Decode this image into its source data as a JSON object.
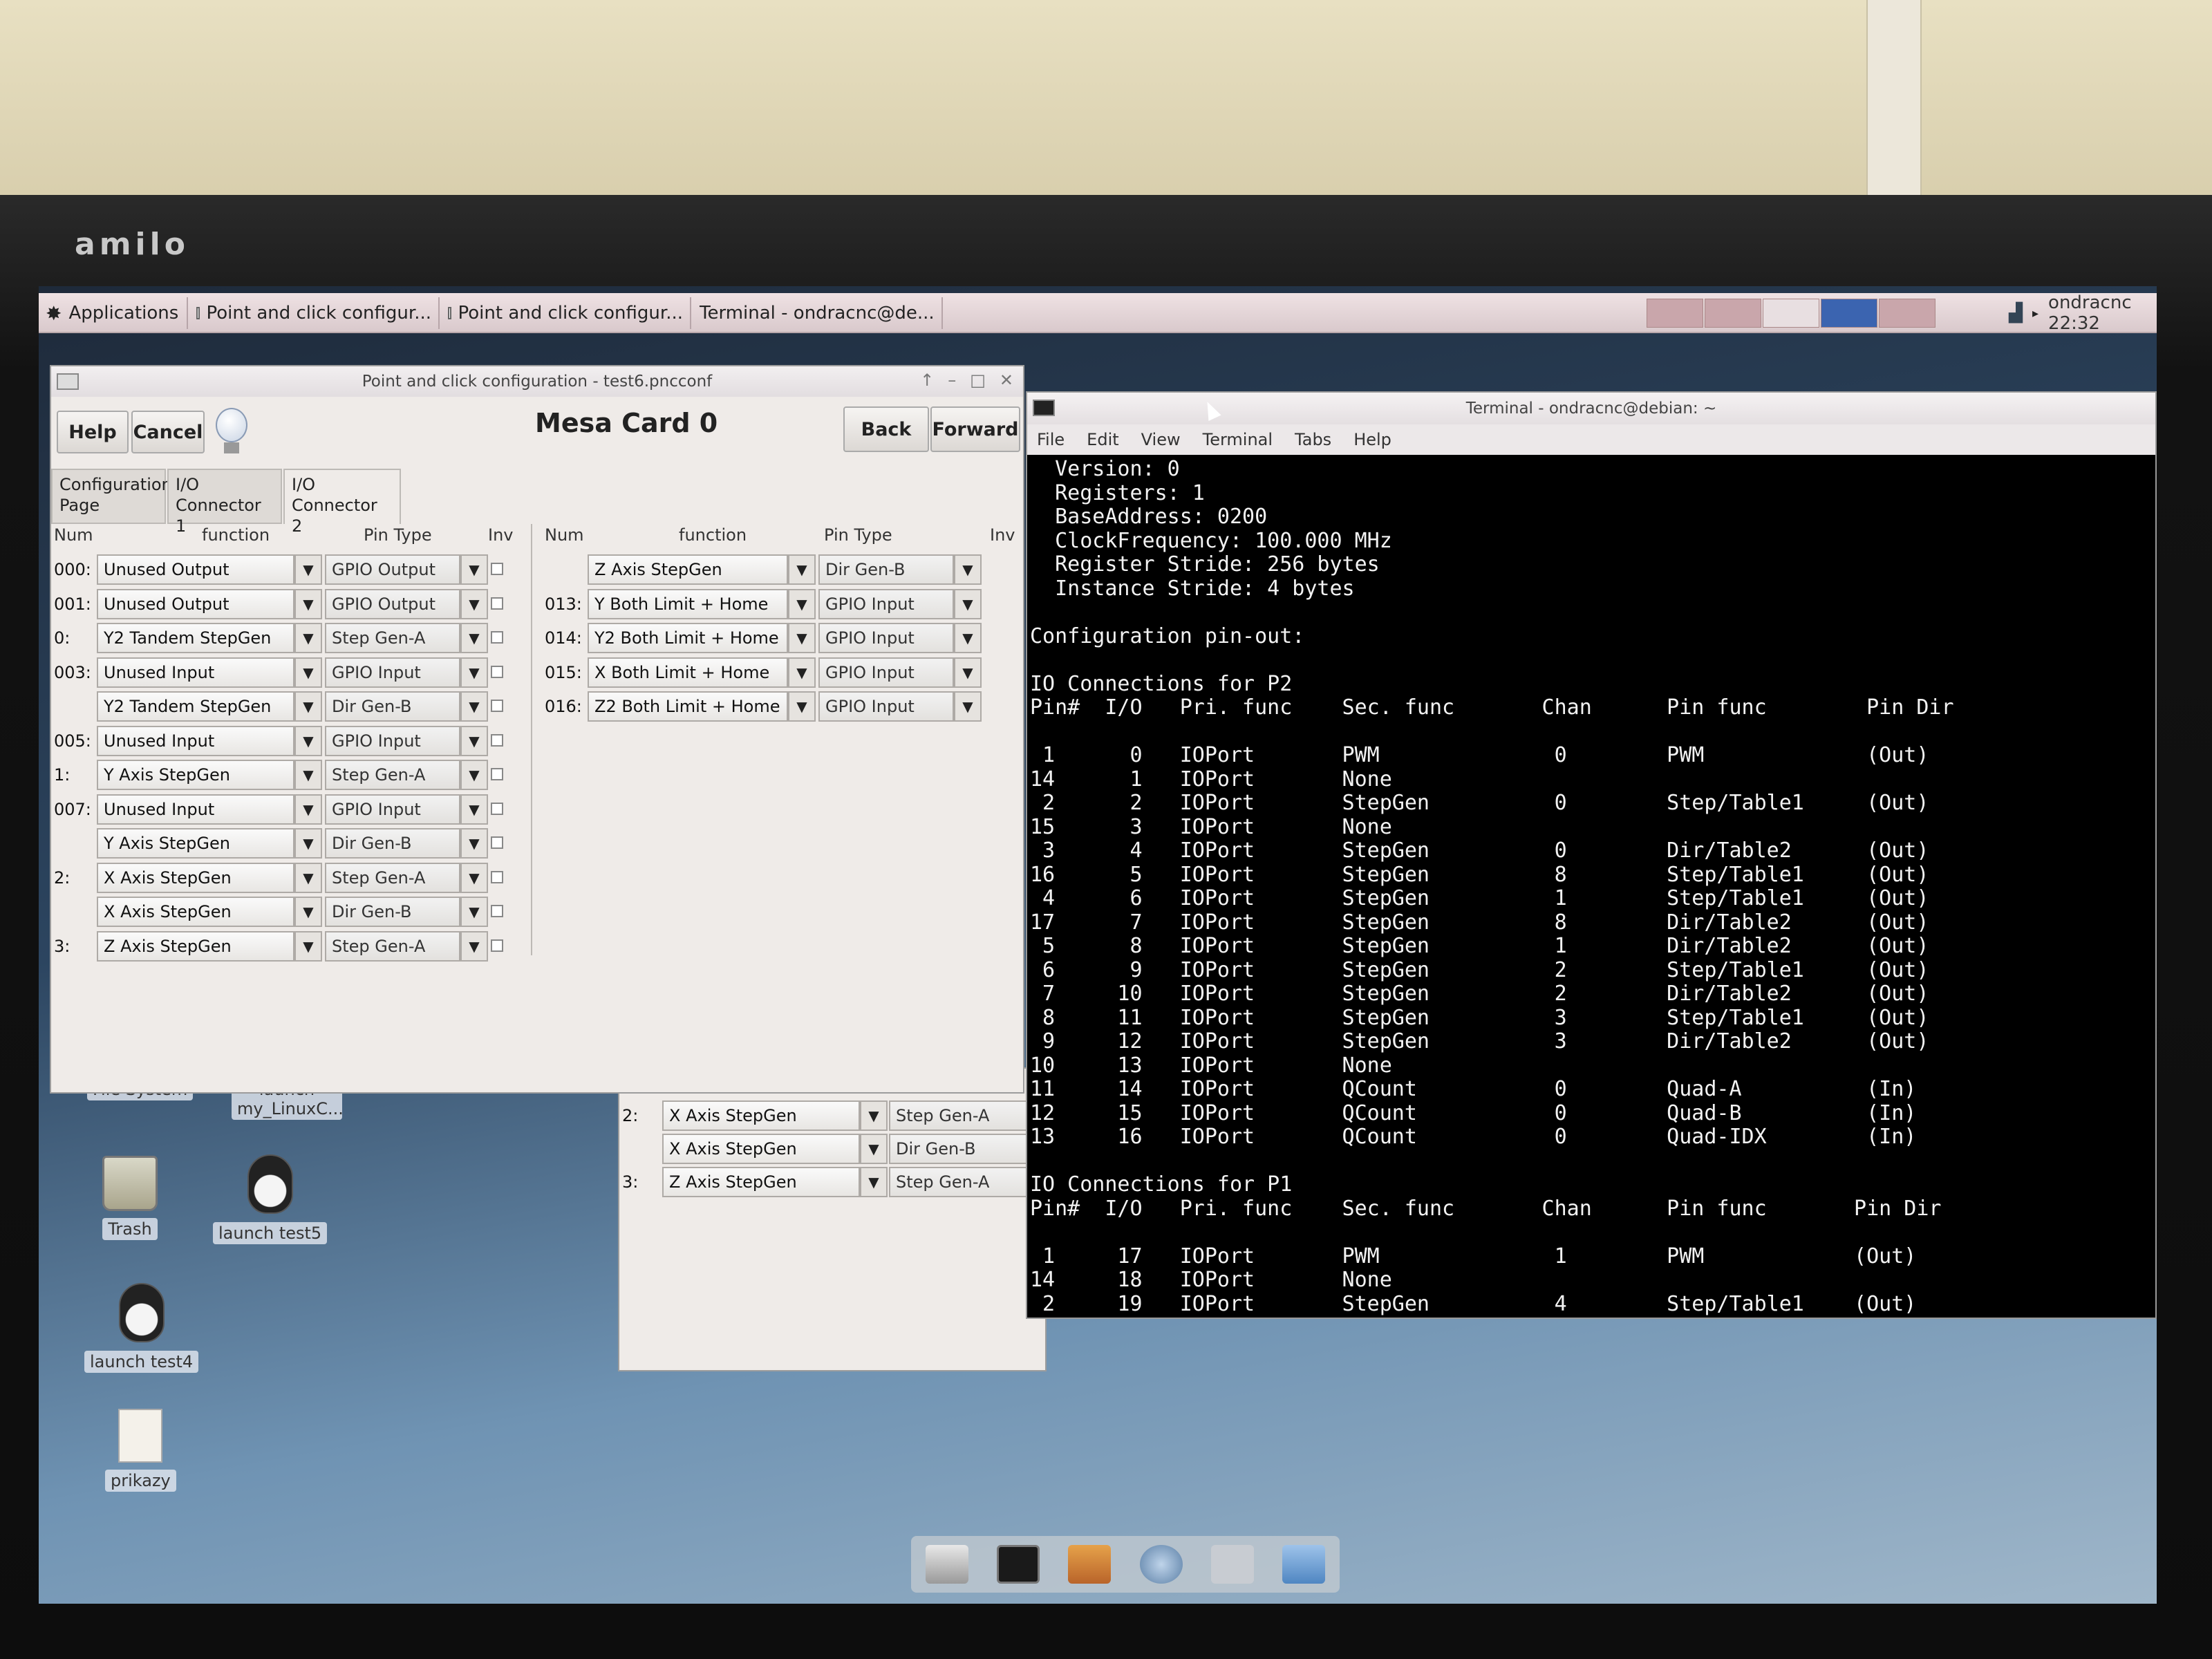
{
  "taskbar": {
    "applications": "Applications",
    "tasks": [
      "Point and click configur...",
      "Point and click configur...",
      "Terminal - ondracnc@de..."
    ],
    "clock": "ondracnc  22:32"
  },
  "config_window": {
    "title": "Point and click configuration - test6.pncconf",
    "help": "Help",
    "cancel": "Cancel",
    "heading": "Mesa Card 0",
    "back": "Back",
    "forward": "Forward",
    "tabs": [
      "Configuration Page",
      "I/O Connector 1",
      "I/O Connector 2"
    ],
    "left_headers": {
      "num": "Num",
      "function": "function",
      "pin_type": "Pin Type",
      "inv": "Inv"
    },
    "right_headers": {
      "num": "Num",
      "function": "function",
      "pin_type": "Pin Type",
      "inv": "Inv"
    },
    "left_rows": [
      {
        "num": "000:",
        "function": "Unused Output",
        "pin_type": "GPIO Output"
      },
      {
        "num": "001:",
        "function": "Unused Output",
        "pin_type": "GPIO Output"
      },
      {
        "num": "0:",
        "function": "Y2 Tandem StepGen",
        "pin_type": "Step Gen-A"
      },
      {
        "num": "003:",
        "function": "Unused Input",
        "pin_type": "GPIO Input"
      },
      {
        "num": "",
        "function": "Y2 Tandem StepGen",
        "pin_type": "Dir Gen-B"
      },
      {
        "num": "005:",
        "function": "Unused Input",
        "pin_type": "GPIO Input"
      },
      {
        "num": "1:",
        "function": "Y Axis StepGen",
        "pin_type": "Step Gen-A"
      },
      {
        "num": "007:",
        "function": "Unused Input",
        "pin_type": "GPIO Input"
      },
      {
        "num": "",
        "function": "Y Axis StepGen",
        "pin_type": "Dir Gen-B"
      },
      {
        "num": "2:",
        "function": "X Axis StepGen",
        "pin_type": "Step Gen-A"
      },
      {
        "num": "",
        "function": "X Axis StepGen",
        "pin_type": "Dir Gen-B"
      },
      {
        "num": "3:",
        "function": "Z Axis StepGen",
        "pin_type": "Step Gen-A"
      }
    ],
    "right_rows": [
      {
        "num": "",
        "function": "Z Axis StepGen",
        "pin_type": "Dir Gen-B"
      },
      {
        "num": "013:",
        "function": "Y Both Limit + Home",
        "pin_type": "GPIO Input"
      },
      {
        "num": "014:",
        "function": "Y2 Both Limit + Home",
        "pin_type": "GPIO Input"
      },
      {
        "num": "015:",
        "function": "X Both Limit + Home",
        "pin_type": "GPIO Input"
      },
      {
        "num": "016:",
        "function": "Z2 Both Limit + Home",
        "pin_type": "GPIO Input"
      }
    ]
  },
  "background_window": {
    "rows": [
      {
        "num": "2:",
        "function": "X Axis StepGen",
        "pin_type": "Step Gen-A"
      },
      {
        "num": "",
        "function": "X Axis StepGen",
        "pin_type": "Dir Gen-B"
      },
      {
        "num": "3:",
        "function": "Z Axis StepGen",
        "pin_type": "Step Gen-A"
      }
    ]
  },
  "terminal": {
    "title": "Terminal - ondracnc@debian: ~",
    "menu": [
      "File",
      "Edit",
      "View",
      "Terminal",
      "Tabs",
      "Help"
    ],
    "lines": [
      "  Version: 0",
      "  Registers: 1",
      "  BaseAddress: 0200",
      "  ClockFrequency: 100.000 MHz",
      "  Register Stride: 256 bytes",
      "  Instance Stride: 4 bytes",
      "",
      "Configuration pin-out:",
      "",
      "IO Connections for P2",
      "Pin#  I/O   Pri. func    Sec. func       Chan      Pin func        Pin Dir",
      "",
      " 1      0   IOPort       PWM              0        PWM             (Out)",
      "14      1   IOPort       None",
      " 2      2   IOPort       StepGen          0        Step/Table1     (Out)",
      "15      3   IOPort       None",
      " 3      4   IOPort       StepGen          0        Dir/Table2      (Out)",
      "16      5   IOPort       StepGen          8        Step/Table1     (Out)",
      " 4      6   IOPort       StepGen          1        Step/Table1     (Out)",
      "17      7   IOPort       StepGen          8        Dir/Table2      (Out)",
      " 5      8   IOPort       StepGen          1        Dir/Table2      (Out)",
      " 6      9   IOPort       StepGen          2        Step/Table1     (Out)",
      " 7     10   IOPort       StepGen          2        Dir/Table2      (Out)",
      " 8     11   IOPort       StepGen          3        Step/Table1     (Out)",
      " 9     12   IOPort       StepGen          3        Dir/Table2      (Out)",
      "10     13   IOPort       None",
      "11     14   IOPort       QCount           0        Quad-A          (In)",
      "12     15   IOPort       QCount           0        Quad-B          (In)",
      "13     16   IOPort       QCount           0        Quad-IDX        (In)",
      "",
      "IO Connections for P1",
      "Pin#  I/O   Pri. func    Sec. func       Chan      Pin func       Pin Dir",
      "",
      " 1     17   IOPort       PWM              1        PWM            (Out)",
      "14     18   IOPort       None",
      " 2     19   IOPort       StepGen          4        Step/Table1    (Out)"
    ]
  },
  "desktop_icons": {
    "file_system": "File System",
    "launch_linux": "launch my_LinuxC...",
    "trash": "Trash",
    "launch_test5": "launch test5",
    "launch_test4": "launch test4",
    "prikazy": "prikazy"
  },
  "bezel_brand": "amilo"
}
